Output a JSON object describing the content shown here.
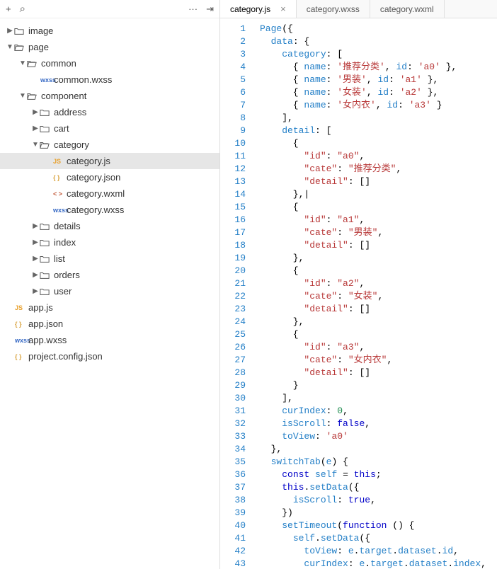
{
  "toolbar": {
    "plus": "+",
    "search_glyph": "⌕",
    "more": "···",
    "collapse_glyph": "⇥"
  },
  "tabs": [
    {
      "label": "category.js",
      "active": true,
      "closable": true
    },
    {
      "label": "category.wxss",
      "active": false,
      "closable": false
    },
    {
      "label": "category.wxml",
      "active": false,
      "closable": false
    }
  ],
  "tree": [
    {
      "depth": 0,
      "chev": "▶",
      "icon": "folder",
      "label": "image"
    },
    {
      "depth": 0,
      "chev": "▼",
      "icon": "folder-open",
      "label": "page"
    },
    {
      "depth": 1,
      "chev": "▼",
      "icon": "folder-open",
      "label": "common"
    },
    {
      "depth": 2,
      "chev": "",
      "icon": "wxss",
      "label": "common.wxss"
    },
    {
      "depth": 1,
      "chev": "▼",
      "icon": "folder-open",
      "label": "component"
    },
    {
      "depth": 2,
      "chev": "▶",
      "icon": "folder",
      "label": "address"
    },
    {
      "depth": 2,
      "chev": "▶",
      "icon": "folder",
      "label": "cart"
    },
    {
      "depth": 2,
      "chev": "▼",
      "icon": "folder-open",
      "label": "category"
    },
    {
      "depth": 3,
      "chev": "",
      "icon": "js",
      "label": "category.js",
      "selected": true
    },
    {
      "depth": 3,
      "chev": "",
      "icon": "json",
      "label": "category.json"
    },
    {
      "depth": 3,
      "chev": "",
      "icon": "wxml",
      "label": "category.wxml"
    },
    {
      "depth": 3,
      "chev": "",
      "icon": "wxss",
      "label": "category.wxss"
    },
    {
      "depth": 2,
      "chev": "▶",
      "icon": "folder",
      "label": "details"
    },
    {
      "depth": 2,
      "chev": "▶",
      "icon": "folder",
      "label": "index"
    },
    {
      "depth": 2,
      "chev": "▶",
      "icon": "folder",
      "label": "list"
    },
    {
      "depth": 2,
      "chev": "▶",
      "icon": "folder",
      "label": "orders"
    },
    {
      "depth": 2,
      "chev": "▶",
      "icon": "folder",
      "label": "user"
    },
    {
      "depth": 0,
      "chev": "",
      "icon": "js",
      "label": "app.js"
    },
    {
      "depth": 0,
      "chev": "",
      "icon": "json",
      "label": "app.json"
    },
    {
      "depth": 0,
      "chev": "",
      "icon": "wxss",
      "label": "app.wxss"
    },
    {
      "depth": 0,
      "chev": "",
      "icon": "json",
      "label": "project.config.json"
    }
  ],
  "icon_text": {
    "js": "JS",
    "json": "{ }",
    "wxml": "< >",
    "wxss": "wxss"
  },
  "code": {
    "first_line": 1,
    "lines": [
      [
        [
          "id",
          "Page"
        ],
        [
          "pun",
          "({"
        ]
      ],
      [
        [
          "pun",
          "  "
        ],
        [
          "prop",
          "data"
        ],
        [
          "pun",
          ": {"
        ]
      ],
      [
        [
          "pun",
          "    "
        ],
        [
          "prop",
          "category"
        ],
        [
          "pun",
          ": ["
        ]
      ],
      [
        [
          "pun",
          "      { "
        ],
        [
          "prop",
          "name"
        ],
        [
          "pun",
          ": "
        ],
        [
          "str",
          "'推荐分类'"
        ],
        [
          "pun",
          ", "
        ],
        [
          "prop",
          "id"
        ],
        [
          "pun",
          ": "
        ],
        [
          "str",
          "'a0'"
        ],
        [
          "pun",
          " },"
        ]
      ],
      [
        [
          "pun",
          "      { "
        ],
        [
          "prop",
          "name"
        ],
        [
          "pun",
          ": "
        ],
        [
          "str",
          "'男装'"
        ],
        [
          "pun",
          ", "
        ],
        [
          "prop",
          "id"
        ],
        [
          "pun",
          ": "
        ],
        [
          "str",
          "'a1'"
        ],
        [
          "pun",
          " },"
        ]
      ],
      [
        [
          "pun",
          "      { "
        ],
        [
          "prop",
          "name"
        ],
        [
          "pun",
          ": "
        ],
        [
          "str",
          "'女装'"
        ],
        [
          "pun",
          ", "
        ],
        [
          "prop",
          "id"
        ],
        [
          "pun",
          ": "
        ],
        [
          "str",
          "'a2'"
        ],
        [
          "pun",
          " },"
        ]
      ],
      [
        [
          "pun",
          "      { "
        ],
        [
          "prop",
          "name"
        ],
        [
          "pun",
          ": "
        ],
        [
          "str",
          "'女内衣'"
        ],
        [
          "pun",
          ", "
        ],
        [
          "prop",
          "id"
        ],
        [
          "pun",
          ": "
        ],
        [
          "str",
          "'a3'"
        ],
        [
          "pun",
          " }"
        ]
      ],
      [
        [
          "pun",
          "    ],"
        ]
      ],
      [
        [
          "pun",
          "    "
        ],
        [
          "prop",
          "detail"
        ],
        [
          "pun",
          ": ["
        ]
      ],
      [
        [
          "pun",
          "      {"
        ]
      ],
      [
        [
          "pun",
          "        "
        ],
        [
          "str",
          "\"id\""
        ],
        [
          "pun",
          ": "
        ],
        [
          "str",
          "\"a0\""
        ],
        [
          "pun",
          ","
        ]
      ],
      [
        [
          "pun",
          "        "
        ],
        [
          "str",
          "\"cate\""
        ],
        [
          "pun",
          ": "
        ],
        [
          "str",
          "\"推荐分类\""
        ],
        [
          "pun",
          ","
        ]
      ],
      [
        [
          "pun",
          "        "
        ],
        [
          "str",
          "\"detail\""
        ],
        [
          "pun",
          ": []"
        ]
      ],
      [
        [
          "pun",
          "      },"
        ],
        [
          "pun",
          "|"
        ]
      ],
      [
        [
          "pun",
          "      {"
        ]
      ],
      [
        [
          "pun",
          "        "
        ],
        [
          "str",
          "\"id\""
        ],
        [
          "pun",
          ": "
        ],
        [
          "str",
          "\"a1\""
        ],
        [
          "pun",
          ","
        ]
      ],
      [
        [
          "pun",
          "        "
        ],
        [
          "str",
          "\"cate\""
        ],
        [
          "pun",
          ": "
        ],
        [
          "str",
          "\"男装\""
        ],
        [
          "pun",
          ","
        ]
      ],
      [
        [
          "pun",
          "        "
        ],
        [
          "str",
          "\"detail\""
        ],
        [
          "pun",
          ": []"
        ]
      ],
      [
        [
          "pun",
          "      },"
        ]
      ],
      [
        [
          "pun",
          "      {"
        ]
      ],
      [
        [
          "pun",
          "        "
        ],
        [
          "str",
          "\"id\""
        ],
        [
          "pun",
          ": "
        ],
        [
          "str",
          "\"a2\""
        ],
        [
          "pun",
          ","
        ]
      ],
      [
        [
          "pun",
          "        "
        ],
        [
          "str",
          "\"cate\""
        ],
        [
          "pun",
          ": "
        ],
        [
          "str",
          "\"女装\""
        ],
        [
          "pun",
          ","
        ]
      ],
      [
        [
          "pun",
          "        "
        ],
        [
          "str",
          "\"detail\""
        ],
        [
          "pun",
          ": []"
        ]
      ],
      [
        [
          "pun",
          "      },"
        ]
      ],
      [
        [
          "pun",
          "      {"
        ]
      ],
      [
        [
          "pun",
          "        "
        ],
        [
          "str",
          "\"id\""
        ],
        [
          "pun",
          ": "
        ],
        [
          "str",
          "\"a3\""
        ],
        [
          "pun",
          ","
        ]
      ],
      [
        [
          "pun",
          "        "
        ],
        [
          "str",
          "\"cate\""
        ],
        [
          "pun",
          ": "
        ],
        [
          "str",
          "\"女内衣\""
        ],
        [
          "pun",
          ","
        ]
      ],
      [
        [
          "pun",
          "        "
        ],
        [
          "str",
          "\"detail\""
        ],
        [
          "pun",
          ": []"
        ]
      ],
      [
        [
          "pun",
          "      }"
        ]
      ],
      [
        [
          "pun",
          "    ],"
        ]
      ],
      [
        [
          "pun",
          "    "
        ],
        [
          "prop",
          "curIndex"
        ],
        [
          "pun",
          ": "
        ],
        [
          "num",
          "0"
        ],
        [
          "pun",
          ","
        ]
      ],
      [
        [
          "pun",
          "    "
        ],
        [
          "prop",
          "isScroll"
        ],
        [
          "pun",
          ": "
        ],
        [
          "bool",
          "false"
        ],
        [
          "pun",
          ","
        ]
      ],
      [
        [
          "pun",
          "    "
        ],
        [
          "prop",
          "toView"
        ],
        [
          "pun",
          ": "
        ],
        [
          "str",
          "'a0'"
        ]
      ],
      [
        [
          "pun",
          "  },"
        ]
      ],
      [
        [
          "pun",
          "  "
        ],
        [
          "id",
          "switchTab"
        ],
        [
          "pun",
          "("
        ],
        [
          "id",
          "e"
        ],
        [
          "pun",
          ") {"
        ]
      ],
      [
        [
          "pun",
          "    "
        ],
        [
          "kw",
          "const"
        ],
        [
          "pun",
          " "
        ],
        [
          "id",
          "self"
        ],
        [
          "pun",
          " = "
        ],
        [
          "kw",
          "this"
        ],
        [
          "pun",
          ";"
        ]
      ],
      [
        [
          "pun",
          "    "
        ],
        [
          "kw",
          "this"
        ],
        [
          "pun",
          "."
        ],
        [
          "id",
          "setData"
        ],
        [
          "pun",
          "({"
        ]
      ],
      [
        [
          "pun",
          "      "
        ],
        [
          "prop",
          "isScroll"
        ],
        [
          "pun",
          ": "
        ],
        [
          "bool",
          "true"
        ],
        [
          "pun",
          ","
        ]
      ],
      [
        [
          "pun",
          "    })"
        ]
      ],
      [
        [
          "pun",
          "    "
        ],
        [
          "id",
          "setTimeout"
        ],
        [
          "pun",
          "("
        ],
        [
          "kw",
          "function"
        ],
        [
          "pun",
          " () {"
        ]
      ],
      [
        [
          "pun",
          "      "
        ],
        [
          "id",
          "self"
        ],
        [
          "pun",
          "."
        ],
        [
          "id",
          "setData"
        ],
        [
          "pun",
          "({"
        ]
      ],
      [
        [
          "pun",
          "        "
        ],
        [
          "prop",
          "toView"
        ],
        [
          "pun",
          ": "
        ],
        [
          "id",
          "e"
        ],
        [
          "pun",
          "."
        ],
        [
          "id",
          "target"
        ],
        [
          "pun",
          "."
        ],
        [
          "id",
          "dataset"
        ],
        [
          "pun",
          "."
        ],
        [
          "id",
          "id"
        ],
        [
          "pun",
          ","
        ]
      ],
      [
        [
          "pun",
          "        "
        ],
        [
          "prop",
          "curIndex"
        ],
        [
          "pun",
          ": "
        ],
        [
          "id",
          "e"
        ],
        [
          "pun",
          "."
        ],
        [
          "id",
          "target"
        ],
        [
          "pun",
          "."
        ],
        [
          "id",
          "dataset"
        ],
        [
          "pun",
          "."
        ],
        [
          "id",
          "index"
        ],
        [
          "pun",
          ","
        ]
      ]
    ]
  }
}
